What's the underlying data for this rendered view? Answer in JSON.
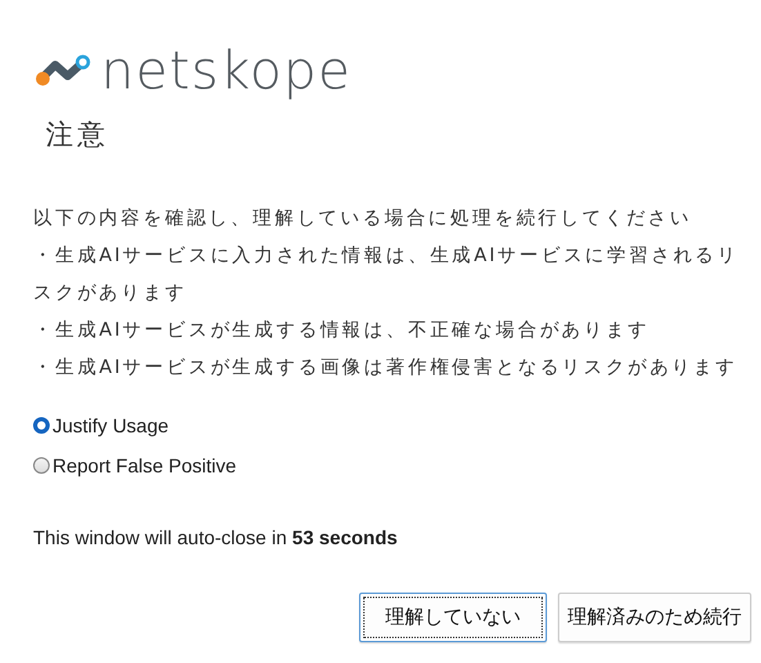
{
  "logo": {
    "text": "netskope"
  },
  "title": "注意",
  "message": [
    "以下の内容を確認し、理解している場合に処理を続行してください",
    "・生成AIサービスに入力された情報は、生成AIサービスに学習されるリスクがあります",
    "・生成AIサービスが生成する情報は、不正確な場合があります",
    "・生成AIサービスが生成する画像は著作権侵害となるリスクがあります"
  ],
  "options": [
    {
      "label": "Justify Usage",
      "selected": true
    },
    {
      "label": "Report False Positive",
      "selected": false
    }
  ],
  "auto_close": "This window will auto-close in **53 seconds**",
  "buttons": [
    {
      "label": "理解していない",
      "focused": true
    },
    {
      "label": "理解済みのため続行",
      "focused": false
    }
  ]
}
